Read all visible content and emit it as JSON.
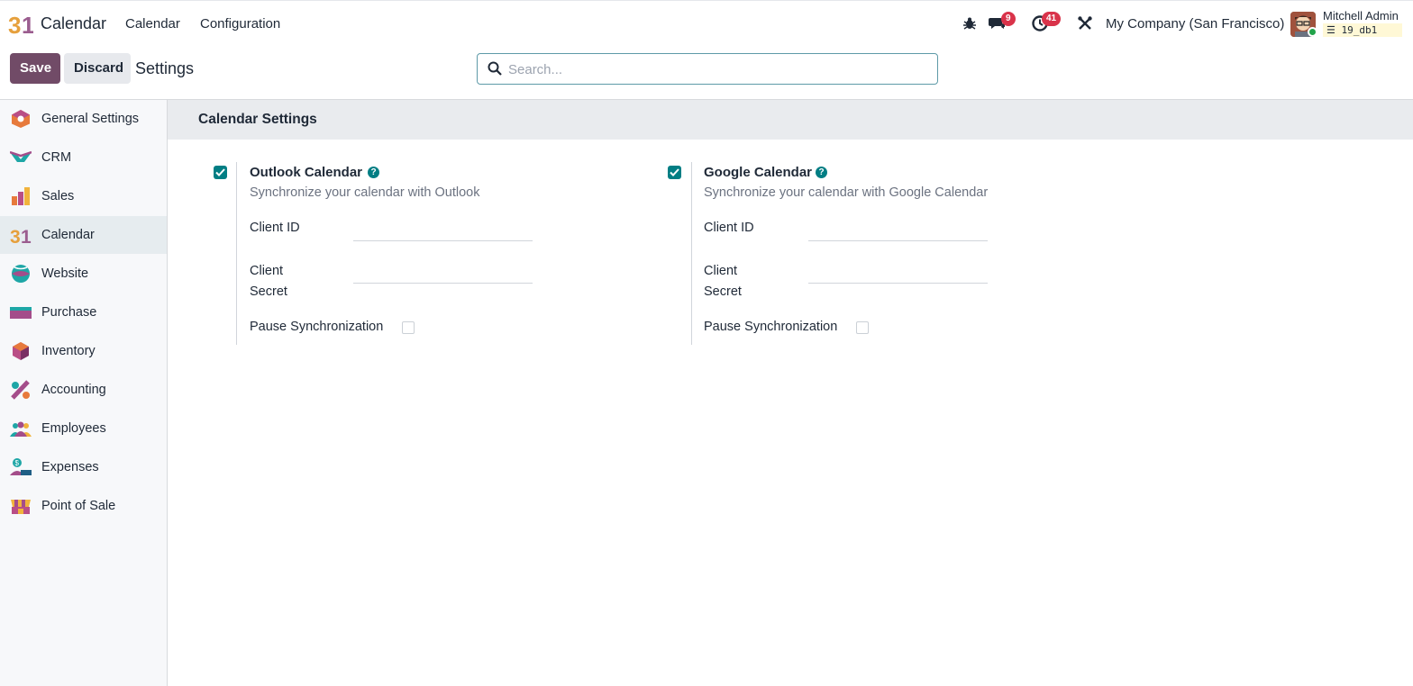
{
  "navbar": {
    "app_name": "Calendar",
    "logo_text": "31",
    "menu": [
      {
        "label": "Calendar"
      },
      {
        "label": "Configuration"
      }
    ],
    "messages_count": "9",
    "activities_count": "41",
    "company": "My Company (San Francisco)",
    "user_name": "Mitchell Admin",
    "database": "19_db1"
  },
  "control_panel": {
    "save_label": "Save",
    "discard_label": "Discard",
    "breadcrumb": "Settings",
    "search_placeholder": "Search..."
  },
  "sidebar": {
    "items": [
      {
        "label": "General Settings",
        "icon": "general-settings-icon"
      },
      {
        "label": "CRM",
        "icon": "crm-icon"
      },
      {
        "label": "Sales",
        "icon": "sales-icon"
      },
      {
        "label": "Calendar",
        "icon": "calendar-icon",
        "active": true
      },
      {
        "label": "Website",
        "icon": "website-icon"
      },
      {
        "label": "Purchase",
        "icon": "purchase-icon"
      },
      {
        "label": "Inventory",
        "icon": "inventory-icon"
      },
      {
        "label": "Accounting",
        "icon": "accounting-icon"
      },
      {
        "label": "Employees",
        "icon": "employees-icon"
      },
      {
        "label": "Expenses",
        "icon": "expenses-icon"
      },
      {
        "label": "Point of Sale",
        "icon": "point-of-sale-icon"
      }
    ]
  },
  "section": {
    "title": "Calendar Settings",
    "outlook": {
      "enabled": true,
      "title": "Outlook Calendar",
      "description": "Synchronize your calendar with Outlook",
      "client_id_label": "Client ID",
      "client_secret_label_1": "Client",
      "client_secret_label_2": "Secret",
      "pause_label": "Pause Synchronization",
      "pause_checked": false,
      "client_id_value": "",
      "client_secret_value": ""
    },
    "google": {
      "enabled": true,
      "title": "Google Calendar",
      "description": "Synchronize your calendar with Google Calendar",
      "client_id_label": "Client ID",
      "client_secret_label_1": "Client",
      "client_secret_label_2": "Secret",
      "pause_label": "Pause Synchronization",
      "pause_checked": false,
      "client_id_value": "",
      "client_secret_value": ""
    }
  },
  "colors": {
    "brand": "#714b67",
    "accent": "#017e84",
    "badge": "#d9334a"
  }
}
